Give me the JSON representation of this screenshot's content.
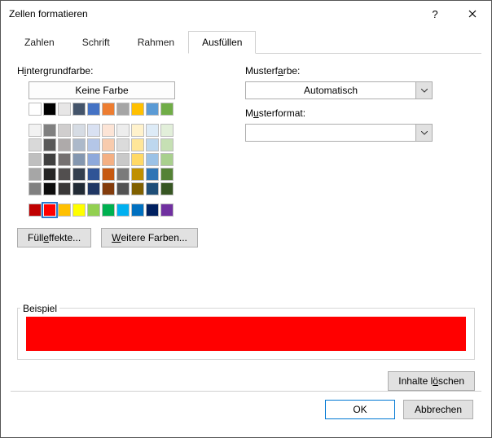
{
  "window": {
    "title": "Zellen formatieren"
  },
  "tabs": [
    "Zahlen",
    "Schrift",
    "Rahmen",
    "Ausfüllen"
  ],
  "active_tab": 3,
  "fill": {
    "bg_label": "Hintergrundfarbe:",
    "nocolor": "Keine Farbe",
    "theme_row": [
      "#ffffff",
      "#000000",
      "#e7e6e6",
      "#44546a",
      "#4472c4",
      "#ed7d31",
      "#a5a5a5",
      "#ffc000",
      "#5b9bd5",
      "#70ad47"
    ],
    "theme_shades": [
      [
        "#f2f2f2",
        "#808080",
        "#d0cece",
        "#d6dce4",
        "#d9e1f2",
        "#fce4d6",
        "#ededed",
        "#fff2cc",
        "#ddebf7",
        "#e2efda"
      ],
      [
        "#d9d9d9",
        "#595959",
        "#aeaaaa",
        "#acb9ca",
        "#b4c6e7",
        "#f8cbad",
        "#dbdbdb",
        "#ffe699",
        "#bdd7ee",
        "#c6e0b4"
      ],
      [
        "#bfbfbf",
        "#404040",
        "#757171",
        "#8497b0",
        "#8ea9db",
        "#f4b084",
        "#c9c9c9",
        "#ffd966",
        "#9bc2e6",
        "#a9d08e"
      ],
      [
        "#a6a6a6",
        "#262626",
        "#524f4f",
        "#333f4f",
        "#305496",
        "#c65911",
        "#7b7b7b",
        "#bf8f00",
        "#2f75b5",
        "#548235"
      ],
      [
        "#808080",
        "#0d0d0d",
        "#3a3838",
        "#222b35",
        "#203764",
        "#833c0c",
        "#525252",
        "#806000",
        "#1f4e78",
        "#375623"
      ]
    ],
    "standard_row": [
      "#c00000",
      "#ff0000",
      "#ffc000",
      "#ffff00",
      "#92d050",
      "#00b050",
      "#00b0f0",
      "#0070c0",
      "#002060",
      "#7030a0"
    ],
    "selected_standard_index": 1,
    "fill_effects": "Fülleffekte...",
    "more_colors": "Weitere Farben..."
  },
  "pattern": {
    "color_label": "Musterfarbe:",
    "color_value": "Automatisch",
    "format_label": "Musterformat:",
    "format_value": ""
  },
  "example": {
    "label": "Beispiel",
    "color": "#ff0000"
  },
  "clear": "Inhalte löschen",
  "footer": {
    "ok": "OK",
    "cancel": "Abbrechen"
  }
}
